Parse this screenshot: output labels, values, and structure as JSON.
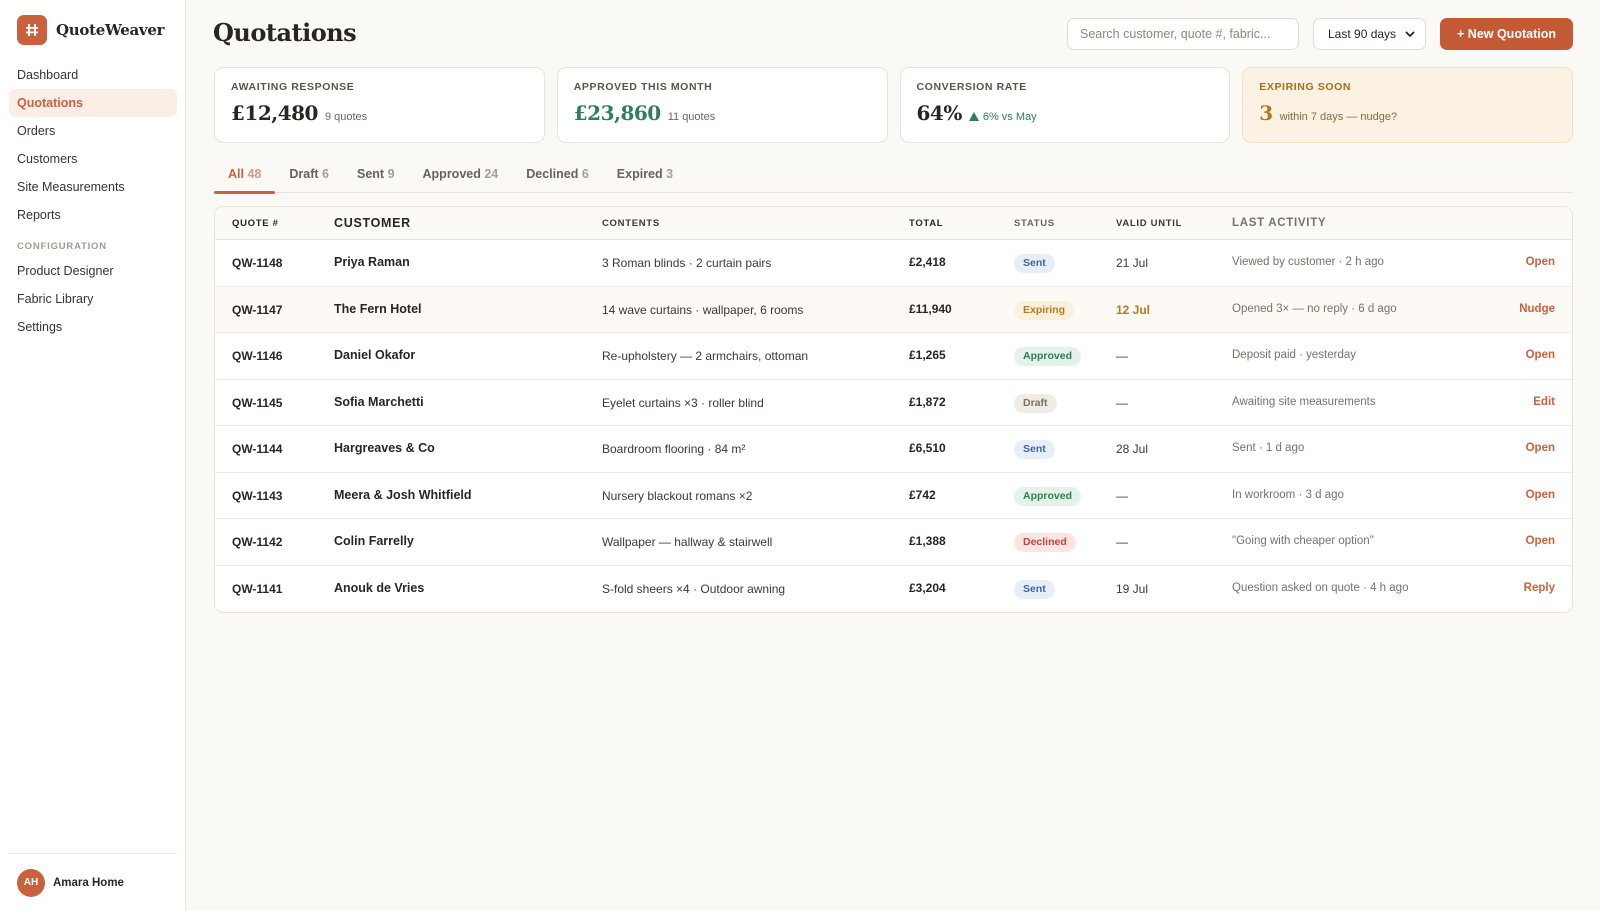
{
  "app": {
    "name": "QuoteWeaver",
    "page_title": "Quotations"
  },
  "sidebar": {
    "items": [
      {
        "label": "Dashboard"
      },
      {
        "label": "Quotations"
      },
      {
        "label": "Orders"
      },
      {
        "label": "Customers"
      },
      {
        "label": "Site Measurements"
      },
      {
        "label": "Reports"
      }
    ],
    "section_label": "CONFIGURATION",
    "config_items": [
      {
        "label": "Product Designer"
      },
      {
        "label": "Fabric Library"
      },
      {
        "label": "Settings"
      }
    ],
    "user": {
      "initials": "AH",
      "name": "Amara Home"
    }
  },
  "header": {
    "search_placeholder": "Search customer, quote #, fabric...",
    "range_value": "Last 90 days",
    "new_button": "+ New Quotation"
  },
  "kpis": [
    {
      "label": "AWAITING RESPONSE",
      "value": "£12,480",
      "sub": "9 quotes"
    },
    {
      "label": "APPROVED THIS MONTH",
      "value": "£23,860",
      "sub": "11 quotes"
    },
    {
      "label": "CONVERSION RATE",
      "value": "64%",
      "sub": "6% vs May"
    },
    {
      "label": "EXPIRING SOON",
      "value": "3",
      "sub": "within 7 days — nudge?"
    }
  ],
  "tabs": [
    {
      "label": "All",
      "count": "48"
    },
    {
      "label": "Draft",
      "count": "6"
    },
    {
      "label": "Sent",
      "count": "9"
    },
    {
      "label": "Approved",
      "count": "24"
    },
    {
      "label": "Declined",
      "count": "6"
    },
    {
      "label": "Expired",
      "count": "3"
    }
  ],
  "table": {
    "headers": {
      "quote": "QUOTE #",
      "customer": "CUSTOMER",
      "contents": "CONTENTS",
      "total": "TOTAL",
      "status": "STATUS",
      "valid": "VALID UNTIL",
      "activity": "LAST ACTIVITY"
    },
    "rows": [
      {
        "quote": "QW-1148",
        "customer": "Priya Raman",
        "contents": "3 Roman blinds · 2 curtain pairs",
        "total": "£2,418",
        "status": "Sent",
        "valid": "21 Jul",
        "activity": "Viewed by customer · 2 h ago",
        "action": "Open"
      },
      {
        "quote": "QW-1147",
        "customer": "The Fern Hotel",
        "contents": "14 wave curtains · wallpaper, 6 rooms",
        "total": "£11,940",
        "status": "Expiring",
        "valid": "12 Jul",
        "activity": "Opened 3× — no reply · 6 d ago",
        "action": "Nudge"
      },
      {
        "quote": "QW-1146",
        "customer": "Daniel Okafor",
        "contents": "Re-upholstery — 2 armchairs, ottoman",
        "total": "£1,265",
        "status": "Approved",
        "valid": "—",
        "activity": "Deposit paid · yesterday",
        "action": "Open"
      },
      {
        "quote": "QW-1145",
        "customer": "Sofia Marchetti",
        "contents": "Eyelet curtains ×3 · roller blind",
        "total": "£1,872",
        "status": "Draft",
        "valid": "—",
        "activity": "Awaiting site measurements",
        "action": "Edit"
      },
      {
        "quote": "QW-1144",
        "customer": "Hargreaves & Co",
        "contents": "Boardroom flooring · 84 m²",
        "total": "£6,510",
        "status": "Sent",
        "valid": "28 Jul",
        "activity": "Sent · 1 d ago",
        "action": "Open"
      },
      {
        "quote": "QW-1143",
        "customer": "Meera & Josh Whitfield",
        "contents": "Nursery blackout romans ×2",
        "total": "£742",
        "status": "Approved",
        "valid": "—",
        "activity": "In workroom · 3 d ago",
        "action": "Open"
      },
      {
        "quote": "QW-1142",
        "customer": "Colin Farrelly",
        "contents": "Wallpaper — hallway & stairwell",
        "total": "£1,388",
        "status": "Declined",
        "valid": "—",
        "activity": "\"Going with cheaper option\"",
        "action": "Open"
      },
      {
        "quote": "QW-1141",
        "customer": "Anouk de Vries",
        "contents": "S-fold sheers ×4 · Outdoor awning",
        "total": "£3,204",
        "status": "Sent",
        "valid": "19 Jul",
        "activity": "Question asked on quote · 4 h ago",
        "action": "Reply"
      }
    ]
  },
  "colors": {
    "accent": "#c9623c",
    "green": "#2e7d5b",
    "amber": "#b47a1f",
    "red": "#c0473d",
    "blue": "#3f67a6"
  },
  "icons": [
    "quoteweaver-logo-icon",
    "chevron-down-icon",
    "trend-up-icon"
  ]
}
